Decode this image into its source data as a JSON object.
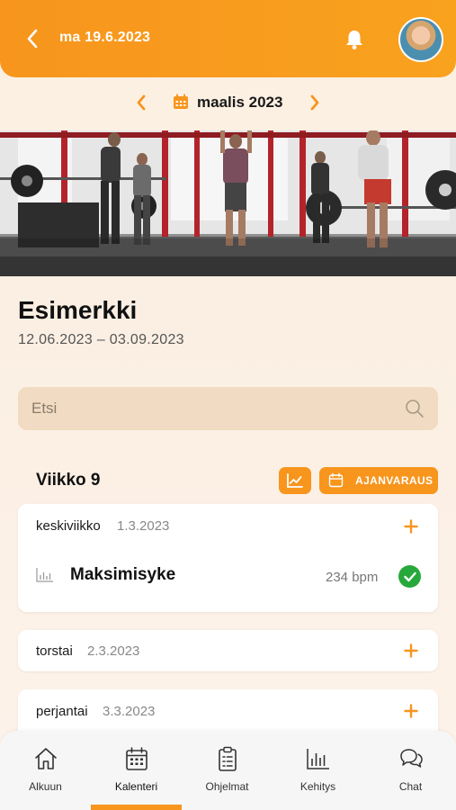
{
  "header": {
    "date_label": "ma 19.6.2023",
    "back_icon": "chevron-left-icon",
    "bell_icon": "bell-icon"
  },
  "month_nav": {
    "label": "maalis 2023"
  },
  "program": {
    "title": "Esimerkki",
    "date_range": "12.06.2023 – 03.09.2023"
  },
  "search": {
    "placeholder": "Etsi",
    "value": ""
  },
  "week": {
    "title": "Viikko 9",
    "booking_label": "AJANVARAUS"
  },
  "days": [
    {
      "name": "keskiviikko",
      "date": "1.3.2023",
      "exercise": {
        "name": "Maksimisyke",
        "value": "234 bpm",
        "completed": true
      }
    },
    {
      "name": "torstai",
      "date": "2.3.2023"
    },
    {
      "name": "perjantai",
      "date": "3.3.2023"
    }
  ],
  "bottom_nav": [
    {
      "label": "Alkuun",
      "icon": "home-icon"
    },
    {
      "label": "Kalenteri",
      "icon": "calendar-icon",
      "active": true
    },
    {
      "label": "Ohjelmat",
      "icon": "clipboard-icon"
    },
    {
      "label": "Kehitys",
      "icon": "bar-chart-icon"
    },
    {
      "label": "Chat",
      "icon": "chat-icon"
    }
  ],
  "colors": {
    "accent": "#f7951d",
    "success": "#27a83a"
  }
}
